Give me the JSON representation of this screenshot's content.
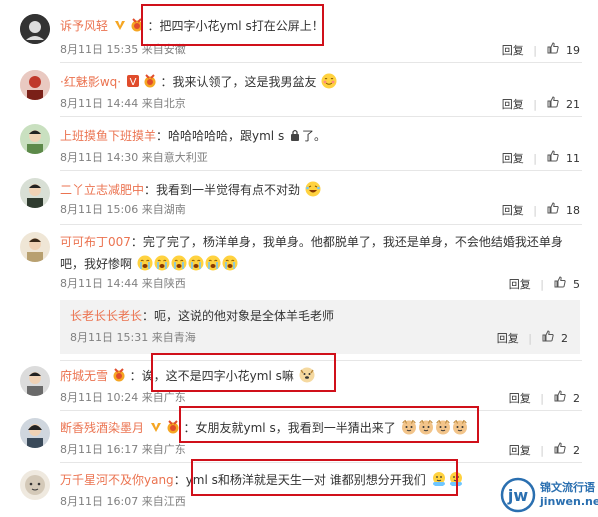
{
  "comments": [
    {
      "username": "诉予风轻",
      "text": "：把四字小花yml s打在公屏上！",
      "meta": "8月11日 15:35 来自安徽",
      "reply_label": "回复",
      "likes": "19",
      "avatar_color": "#333333"
    },
    {
      "username": "·红魅影wq·",
      "text": "：我来认领了，这是我男盆友",
      "meta": "8月11日 14:44 来自北京",
      "reply_label": "回复",
      "likes": "21",
      "avatar_color": "#c0392b"
    },
    {
      "username": "上班摸鱼下班摸羊",
      "text": "：哈哈哈哈哈，跟yml s",
      "text_suffix": "了。",
      "meta": "8月11日 14:30 来自意大利亚",
      "reply_label": "回复",
      "likes": "11",
      "avatar_color": "#5d8a4a"
    },
    {
      "username": "二丫立志减肥中",
      "text": "：我看到一半觉得有点不对劲",
      "meta": "8月11日 15:06 来自湖南",
      "reply_label": "回复",
      "likes": "18",
      "avatar_color": "#2f3b2f"
    },
    {
      "username": "可可布丁007",
      "text_line1": "：完了完了，杨洋单身，我单身。他都脱单了，我还是单身，不会他结婚我还单身",
      "text_line2": "吧，我好惨啊",
      "meta": "8月11日 14:44 来自陕西",
      "reply_label": "回复",
      "likes": "5",
      "avatar_color": "#b8a070"
    },
    {
      "username": "府城无雪",
      "text": "：诶，这不是四字小花yml s嘛",
      "meta": "8月11日 10:24 来自广东",
      "reply_label": "回复",
      "likes": "2",
      "avatar_color": "#6a6a6a"
    },
    {
      "username": "断香残酒染墨月",
      "text": "：女朋友就yml s，我看到一半猜出来了",
      "meta": "8月11日 16:17 来自广东",
      "reply_label": "回复",
      "likes": "2",
      "avatar_color": "#3a4a5a"
    },
    {
      "username": "万千星河不及你yang",
      "text": "：yml s和杨洋就是天生一对 谁都别想分开我们",
      "meta": "8月11日 16:07 来自江西",
      "avatar_color": "#d4c9b8"
    }
  ],
  "nested_reply": {
    "username": "长老长长老长",
    "text": "：呃，这说的他对象是全体羊毛老师",
    "meta": "8月11日 15:31 来自青海",
    "reply_label": "回复",
    "likes": "2"
  },
  "watermark": {
    "title": "锦文流行语",
    "url": "jinwen.net"
  },
  "colors": {
    "username": "#eb7350",
    "highlight_box": "#d0101a",
    "meta": "#808080"
  }
}
